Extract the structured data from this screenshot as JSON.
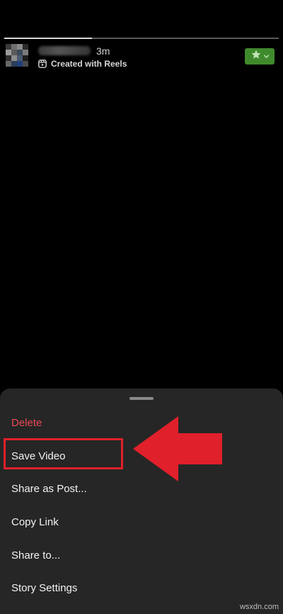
{
  "story": {
    "progress": 0.32,
    "time": "3m",
    "reels_label": "Created with Reels",
    "favorite_color": "#3f8a2c"
  },
  "menu": {
    "items": [
      {
        "label": "Delete",
        "style": "danger"
      },
      {
        "label": "Save Video",
        "style": "normal"
      },
      {
        "label": "Share as Post...",
        "style": "normal"
      },
      {
        "label": "Copy Link",
        "style": "normal"
      },
      {
        "label": "Share to...",
        "style": "normal"
      },
      {
        "label": "Story Settings",
        "style": "normal"
      }
    ],
    "highlight_color": "#e0202a"
  },
  "watermark": "wsxdn.com"
}
